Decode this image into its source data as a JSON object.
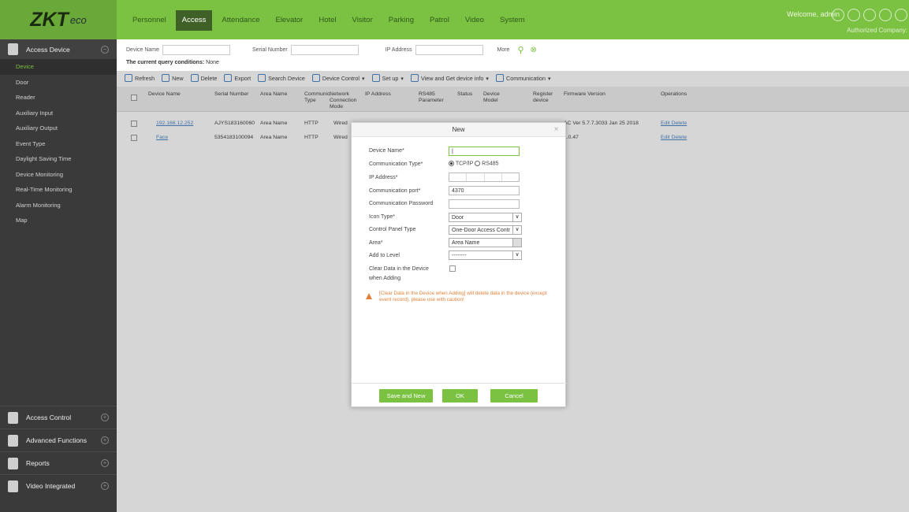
{
  "brand": {
    "logo_main": "ZKT",
    "logo_sub": "eco"
  },
  "topnav": [
    "Personnel",
    "Access",
    "Attendance",
    "Elevator",
    "Hotel",
    "Visitor",
    "Parking",
    "Patrol",
    "Video",
    "System"
  ],
  "header": {
    "welcome": "Welcome, admin",
    "company": "Authorized Company: "
  },
  "sidebar": {
    "section": "Access Device",
    "items": [
      "Device",
      "Door",
      "Reader",
      "Auxiliary Input",
      "Auxiliary Output",
      "Event Type",
      "Daylight Saving Time",
      "Device Monitoring",
      "Real-Time Monitoring",
      "Alarm Monitoring",
      "Map"
    ],
    "bottom": [
      "Access Control",
      "Advanced Functions",
      "Reports",
      "Video Integrated"
    ]
  },
  "query": {
    "device_name_label": "Device Name",
    "serial_label": "Serial Number",
    "ip_label": "IP Address",
    "more": "More",
    "conditions_label": "The current query conditions:",
    "conditions_value": "None"
  },
  "toolbar": [
    "Refresh",
    "New",
    "Delete",
    "Export",
    "Search Device",
    "Device Control",
    "Set up",
    "View and Get device info",
    "Communication"
  ],
  "table": {
    "headers": [
      "Device Name",
      "Serial Number",
      "Area Name",
      "Communic. Type",
      "Network Connection Mode",
      "IP Address",
      "RS485 Parameter",
      "Status",
      "Device Model",
      "Register device",
      "Firmware Version",
      "Operations"
    ],
    "rows": [
      {
        "name": "192.168.12.252",
        "serial": "AJYS183160060",
        "area": "Area Name",
        "comm": "HTTP",
        "network": "Wired",
        "firmware": "AC Ver 5.7.7.3033 Jan 25 2018",
        "ops": "Edit Delete"
      },
      {
        "name": "Face",
        "serial": "5354183100094",
        "area": "Area Name",
        "comm": "HTTP",
        "network": "Wired",
        "firmware": "1.0.47",
        "ops": "Edit Delete"
      }
    ]
  },
  "modal": {
    "title": "New",
    "device_name_label": "Device Name*",
    "comm_type_label": "Communication Type*",
    "comm_tcp": "TCP/IP",
    "comm_rs485": "RS485",
    "ip_label": "IP Address*",
    "port_label": "Communication port*",
    "port_value": "4370",
    "password_label": "Communication Password",
    "icon_label": "Icon Type*",
    "icon_value": "Door",
    "panel_label": "Control Panel Type",
    "panel_value": "One-Door Access Contr",
    "area_label": "Area*",
    "area_value": "Area Name",
    "level_label": "Add to Level",
    "level_value": "--------",
    "clear_label_1": "Clear Data in the Device",
    "clear_label_2": "when Adding",
    "warning": "[Clear Data in the Device when Adding] will delete data in the device (except event record), please use with caution!",
    "btn_save_new": "Save and New",
    "btn_ok": "OK",
    "btn_cancel": "Cancel"
  }
}
